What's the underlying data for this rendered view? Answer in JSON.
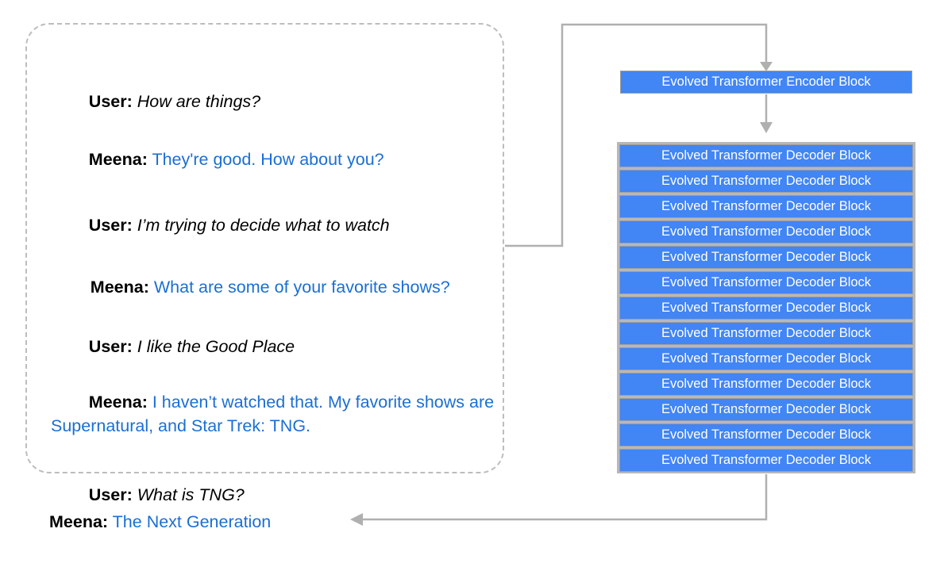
{
  "dialog": {
    "turns": [
      {
        "speaker": "User:",
        "text": "How are things?",
        "style": "user"
      },
      {
        "speaker": "Meena:",
        "text": "They're good. How about you?",
        "style": "meena"
      },
      {
        "speaker": "User:",
        "text": "I’m trying to decide what to watch",
        "style": "user"
      },
      {
        "speaker": "Meena:",
        "text": "What are some of your favorite shows?",
        "style": "meena"
      },
      {
        "speaker": "User:",
        "text": "I like the Good Place",
        "style": "user"
      },
      {
        "speaker": "Meena:",
        "text": "I haven’t watched that. My favorite shows are Supernatural, and Star Trek: TNG.",
        "style": "meena"
      },
      {
        "speaker": "User:",
        "text": "What is TNG?",
        "style": "user"
      }
    ]
  },
  "output": {
    "speaker": "Meena:",
    "text": "The Next Generation"
  },
  "model": {
    "encoder_label": "Evolved Transformer Encoder Block",
    "decoder_label": "Evolved Transformer Decoder Block",
    "decoder_count": 13,
    "block_fill": "#4285f4",
    "block_border": "#9e9e9e",
    "stack_background": "#b8b8b8",
    "block_text_color": "#ffffff"
  },
  "style": {
    "dashed_border_color": "#bdbdbd",
    "connector_color": "#b0b0b0",
    "meena_text_color": "#1a6fd4",
    "user_text_color": "#000000"
  },
  "connectors": [
    {
      "name": "dialog-to-encoder",
      "from": "dialog-box",
      "to": "encoder-block"
    },
    {
      "name": "encoder-to-decoder",
      "from": "encoder-block",
      "to": "decoder-stack"
    },
    {
      "name": "decoder-to-output",
      "from": "decoder-stack",
      "to": "output-line"
    }
  ]
}
